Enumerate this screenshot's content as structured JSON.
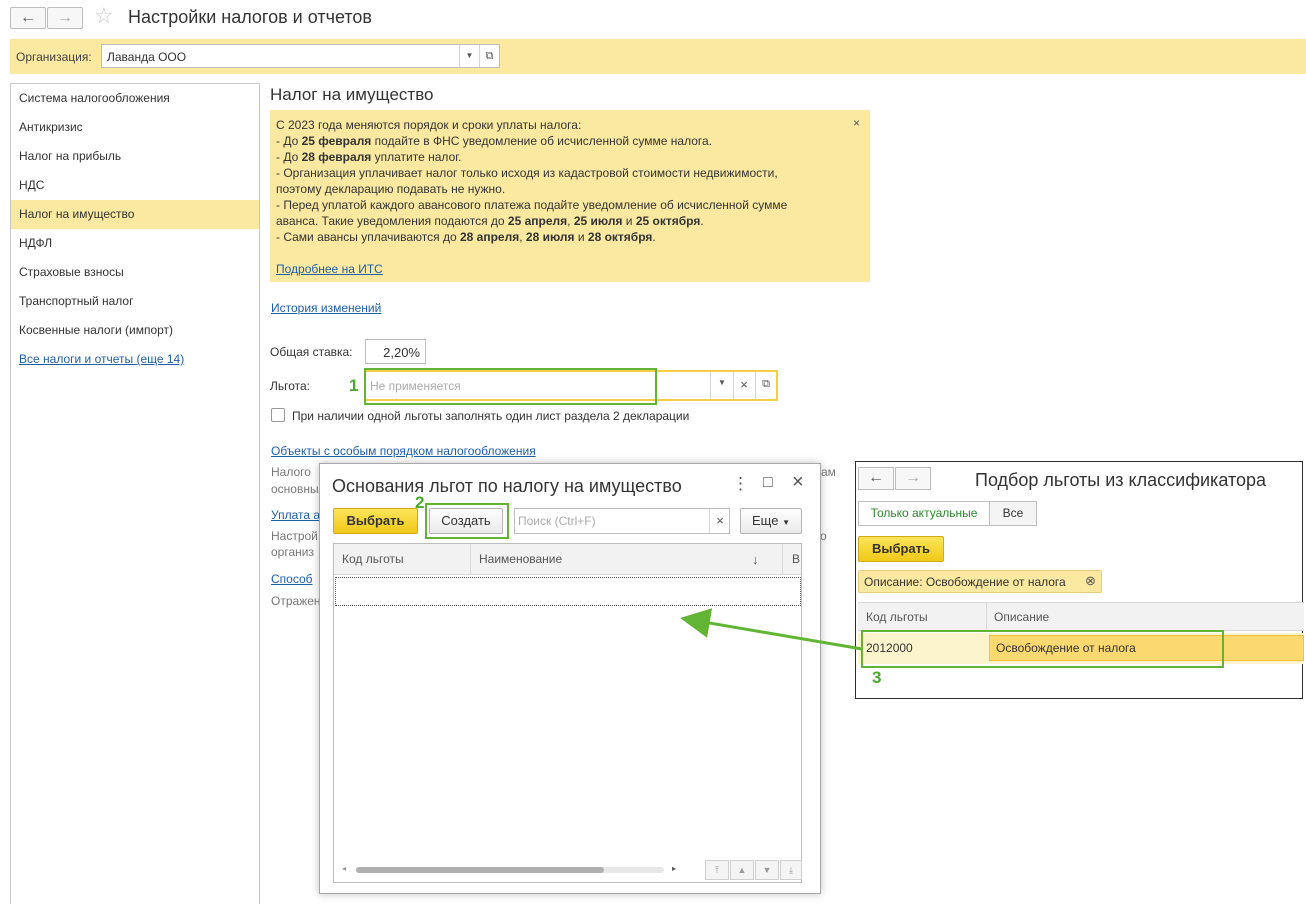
{
  "window": {
    "title": "Настройки налогов и отчетов",
    "back_icon": "←",
    "forward_icon": "→",
    "star_icon": "☆"
  },
  "org": {
    "label": "Организация:",
    "value": "Лаванда ООО"
  },
  "sidebar": {
    "items": [
      {
        "label": "Система налогообложения"
      },
      {
        "label": "Антикризис"
      },
      {
        "label": "Налог на прибыль"
      },
      {
        "label": "НДС"
      },
      {
        "label": "Налог на имущество"
      },
      {
        "label": "НДФЛ"
      },
      {
        "label": "Страховые взносы"
      },
      {
        "label": "Транспортный налог"
      },
      {
        "label": "Косвенные налоги (импорт)"
      },
      {
        "label": "Все налоги и отчеты (еще 14)"
      }
    ]
  },
  "main": {
    "heading": "Налог на имущество",
    "notice": {
      "l1": "С 2023 года меняются порядок и сроки уплаты налога:",
      "l2a": " - До ",
      "l2b": "25 февраля",
      "l2c": " подайте в ФНС уведомление об исчисленной сумме налога.",
      "l3a": " - До ",
      "l3b": "28 февраля",
      "l3c": " уплатите налог.",
      "l4": " - Организация уплачивает налог только исходя из кадастровой стоимости недвижимости,",
      "l5": "поэтому декларацию подавать не нужно.",
      "l6": " - Перед уплатой каждого авансового платежа подайте уведомление об исчисленной сумме",
      "l7a": "аванса. Такие уведомления подаются до ",
      "l7b": "25 апреля",
      "l7c": ", ",
      "l7d": "25 июля",
      "l7e": " и ",
      "l7f": "25 октября",
      "l7g": ".",
      "l8a": " - Сами авансы уплачиваются до ",
      "l8b": "28 апреля",
      "l8c": ", ",
      "l8d": "28 июля",
      "l8e": " и ",
      "l8f": "28 октября",
      "l8g": ".",
      "more_link": "Подробнее на ИТС",
      "close": "×"
    },
    "history_link": "История изменений",
    "rate_label": "Общая ставка:",
    "rate_value": "2,20%",
    "benefit_label": "Льгота:",
    "benefit_placeholder": "Не применяется",
    "checkbox_label": "При наличии одной льготы заполнять один лист раздела 2 декларации",
    "objects_link": "Объекты с особым порядком налогообложения",
    "objects_desc_1a": "Налого",
    "objects_desc_1b": "ам",
    "objects_desc_2": "основны",
    "payment_link": "Уплата а",
    "payment_desc_1a": "Настрой",
    "payment_desc_1b": "о",
    "payment_desc_2": "организ",
    "methods_link": "Способ",
    "reflect_text": "Отражен"
  },
  "markers": {
    "m1": "1",
    "m2": "2",
    "m3": "3"
  },
  "dialog": {
    "title": "Основания льгот по налогу на имущество",
    "menu_icon": "⋮",
    "maximize_icon": "□",
    "close_icon": "×",
    "select_btn": "Выбрать",
    "create_btn": "Создать",
    "search_placeholder": "Поиск (Ctrl+F)",
    "search_clear": "×",
    "more_btn": "Еще",
    "col_code": "Код льготы",
    "col_name": "Наименование",
    "sort_icon": "↓",
    "col_cut": "В"
  },
  "classifier": {
    "title": "Подбор льготы из классификатора",
    "tab_current": "Только актуальные",
    "tab_all": "Все",
    "select_btn": "Выбрать",
    "filter_label": "Описание: Освобождение от налога",
    "filter_clear": "⊗",
    "col_code": "Код льготы",
    "col_desc": "Описание",
    "row_code": "2012000",
    "row_desc": "Освобождение от налога"
  },
  "colors": {
    "accent_yellow": "#fbe9a1",
    "green_marker": "#62b534",
    "link": "#1f5fa8"
  }
}
